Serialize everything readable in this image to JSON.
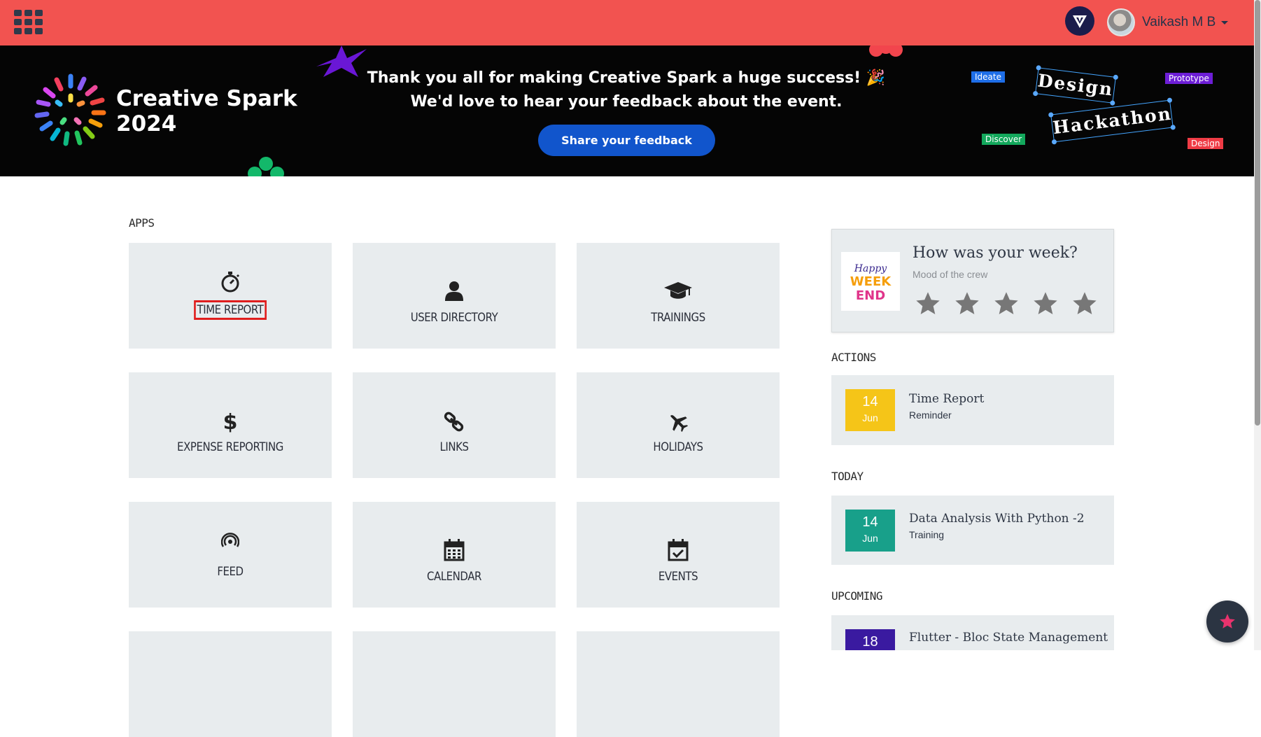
{
  "topbar": {
    "bg": "#f25350",
    "apps_icon": "grid-icon",
    "user_name": "Vaikash M B"
  },
  "banner": {
    "event_title_line1": "Creative Spark",
    "event_title_line2": "2024",
    "message_line1": "Thank you all for making Creative Spark a huge success! 🎉",
    "message_line2": "We'd love to hear your feedback about the event.",
    "button_label": "Share your feedback",
    "tags": {
      "ideate": "Ideate",
      "prototype": "Prototype",
      "discover": "Discover",
      "design": "Design"
    },
    "hackathon_word1": "Design",
    "hackathon_word2": "Hackathon",
    "bg_pattern_text": "Creative Spark"
  },
  "apps": {
    "heading": "APPS",
    "tiles": [
      {
        "label": "TIME REPORT",
        "icon": "stopwatch-icon"
      },
      {
        "label": "USER DIRECTORY",
        "icon": "user-icon"
      },
      {
        "label": "TRAININGS",
        "icon": "graduation-cap-icon"
      },
      {
        "label": "EXPENSE REPORTING",
        "icon": "dollar-icon"
      },
      {
        "label": "LINKS",
        "icon": "link-icon"
      },
      {
        "label": "HOLIDAYS",
        "icon": "plane-icon"
      },
      {
        "label": "FEED",
        "icon": "feed-icon"
      },
      {
        "label": "CALENDAR",
        "icon": "calendar-icon"
      },
      {
        "label": "EVENTS",
        "icon": "calendar-check-icon"
      }
    ]
  },
  "mood": {
    "title": "How was your week?",
    "subtitle": "Mood of the crew",
    "image_text": "Happy WEEK END",
    "stars": 5
  },
  "actions": {
    "heading": "ACTIONS",
    "item": {
      "day": "14",
      "month": "Jun",
      "title": "Time Report",
      "subtitle": "Reminder",
      "color": "#f5c518"
    }
  },
  "today": {
    "heading": "TODAY",
    "item": {
      "day": "14",
      "month": "Jun",
      "title": "Data Analysis With Python -2",
      "subtitle": "Training",
      "color": "#18a08a"
    }
  },
  "upcoming": {
    "heading": "UPCOMING",
    "item": {
      "day": "18",
      "month": "",
      "title": "Flutter - Bloc State Management",
      "color": "#3a1aa0"
    }
  },
  "fab": {
    "icon": "star-icon"
  }
}
